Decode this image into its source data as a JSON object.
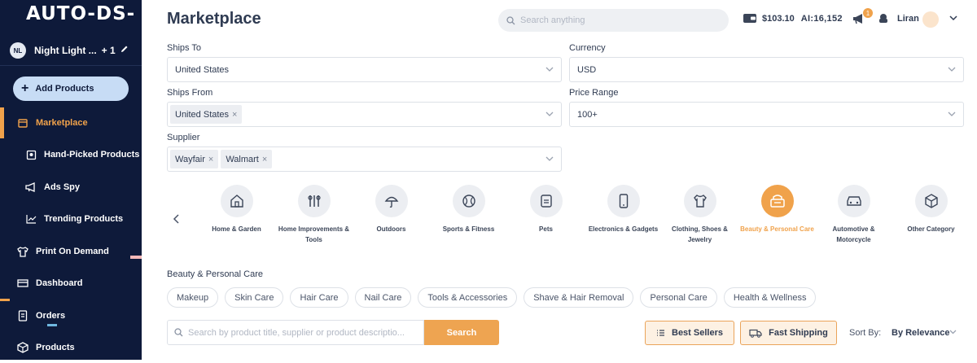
{
  "app": {
    "logo": "AUTO-DS-"
  },
  "store": {
    "initials": "NL",
    "name": "Night Light ...",
    "extra": "+ 1"
  },
  "sidebar": {
    "add_products": "Add Products",
    "items": [
      {
        "label": "Marketplace",
        "icon": "store-icon"
      },
      {
        "label": "Hand-Picked Products",
        "icon": "hand-picked-icon"
      },
      {
        "label": "Ads Spy",
        "icon": "megaphone-icon"
      },
      {
        "label": "Trending Products",
        "icon": "trending-icon"
      },
      {
        "label": "Print On Demand",
        "icon": "shirt-icon"
      },
      {
        "label": "Dashboard",
        "icon": "dashboard-icon"
      },
      {
        "label": "Orders",
        "icon": "orders-icon"
      },
      {
        "label": "Products",
        "icon": "box-icon"
      }
    ]
  },
  "header": {
    "title": "Marketplace",
    "search_placeholder": "Search anything",
    "balance": "$103.10",
    "ai_credits": "AI:16,152",
    "notification_count": "1",
    "user": "Liran"
  },
  "filters": {
    "ships_to": {
      "label": "Ships To",
      "value": "United States"
    },
    "currency": {
      "label": "Currency",
      "value": "USD"
    },
    "ships_from": {
      "label": "Ships From",
      "chips": [
        "United States"
      ]
    },
    "price_range": {
      "label": "Price Range",
      "value": "100+"
    },
    "supplier": {
      "label": "Supplier",
      "chips": [
        "Wayfair",
        "Walmart"
      ]
    }
  },
  "categories": [
    {
      "label": "Home & Garden",
      "icon": "house-icon"
    },
    {
      "label": "Home Improvements & Tools",
      "icon": "tools-icon"
    },
    {
      "label": "Outdoors",
      "icon": "umbrella-icon"
    },
    {
      "label": "Sports & Fitness",
      "icon": "ball-icon"
    },
    {
      "label": "Pets",
      "icon": "pet-food-icon"
    },
    {
      "label": "Electronics & Gadgets",
      "icon": "phone-icon"
    },
    {
      "label": "Clothing, Shoes & Jewelry",
      "icon": "shirt-icon"
    },
    {
      "label": "Beauty & Personal Care",
      "icon": "beauty-icon",
      "selected": true
    },
    {
      "label": "Automotive & Motorcycle",
      "icon": "car-icon"
    },
    {
      "label": "Other Category",
      "icon": "cube-icon"
    }
  ],
  "subcategories": {
    "title": "Beauty & Personal Care",
    "items": [
      "Makeup",
      "Skin Care",
      "Hair Care",
      "Nail Care",
      "Tools & Accessories",
      "Shave & Hair Removal",
      "Personal Care",
      "Health & Wellness"
    ]
  },
  "search": {
    "placeholder": "Search by product title, supplier or product descriptio...",
    "button": "Search"
  },
  "quick_filters": {
    "best_sellers": "Best Sellers",
    "fast_shipping": "Fast Shipping"
  },
  "sort": {
    "label": "Sort By:",
    "value": "By Relevance"
  },
  "colors": {
    "sidebar_bg": "#0e1a3a",
    "accent": "#f0a24b",
    "add_button": "#c7dcf5"
  }
}
